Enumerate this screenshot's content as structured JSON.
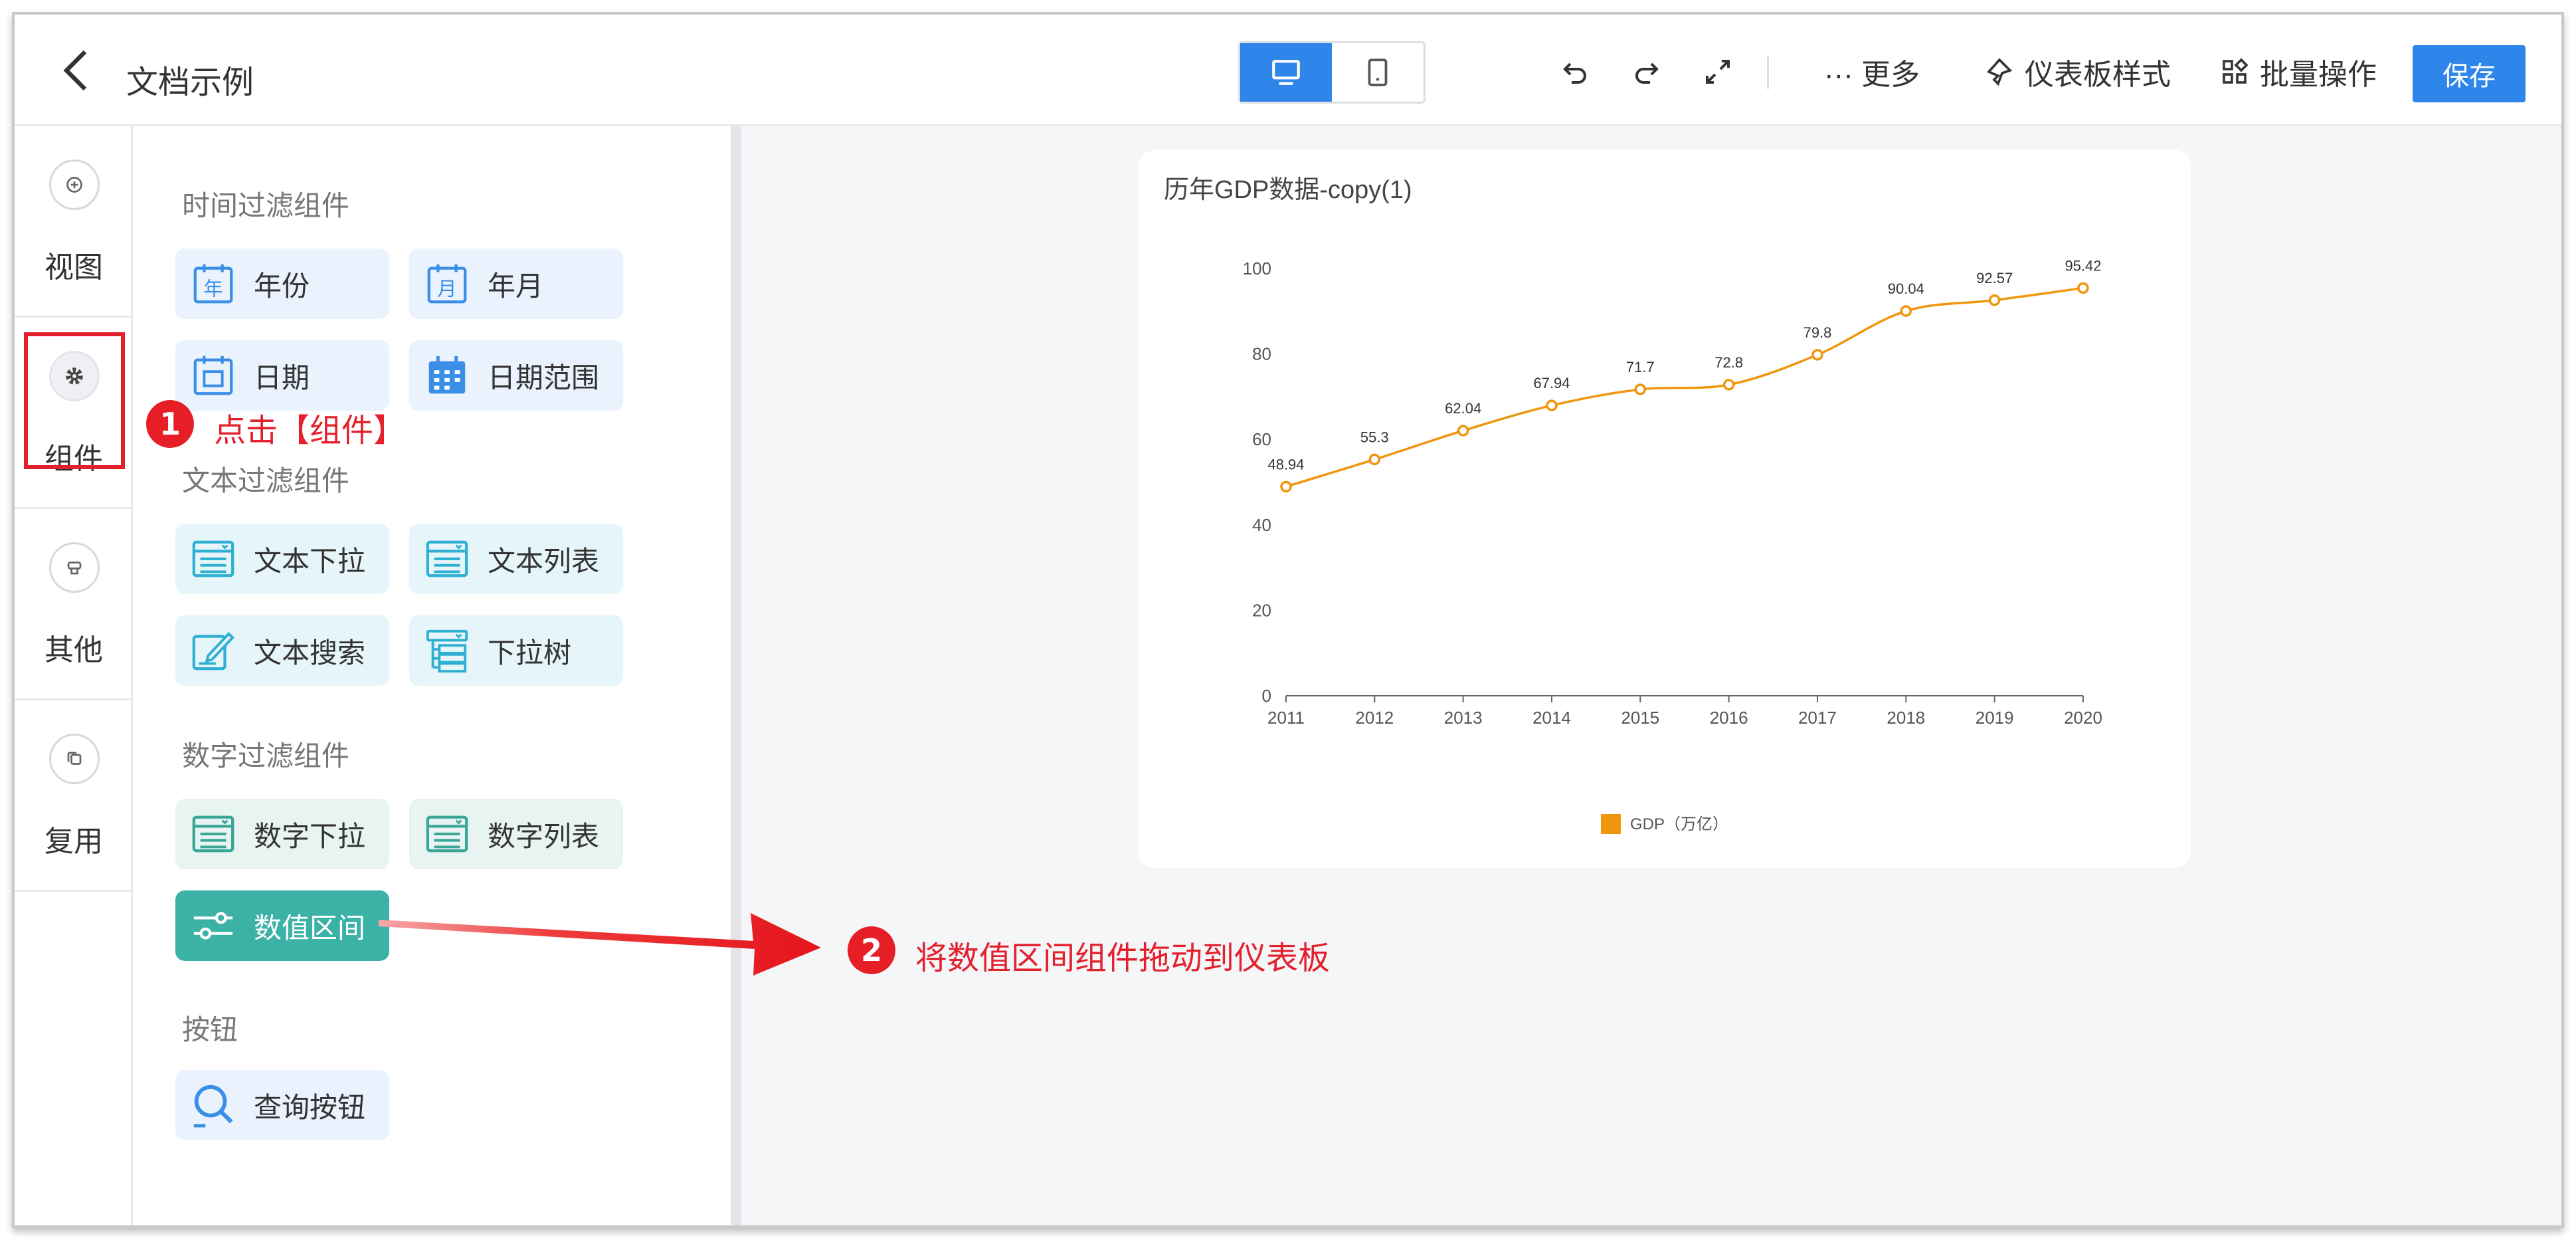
{
  "header": {
    "title": "文档示例",
    "more_label": "··· 更多",
    "dashboard_style_label": "仪表板样式",
    "batch_label": "批量操作",
    "save_label": "保存"
  },
  "rail": {
    "items": [
      {
        "label": "视图",
        "icon": "plus-circle-icon"
      },
      {
        "label": "组件",
        "icon": "gear-icon"
      },
      {
        "label": "其他",
        "icon": "stamp-icon"
      },
      {
        "label": "复用",
        "icon": "copy-icon"
      }
    ]
  },
  "panel": {
    "sections": [
      {
        "title": "时间过滤组件"
      },
      {
        "title": "文本过滤组件"
      },
      {
        "title": "数字过滤组件"
      },
      {
        "title": "按钮"
      }
    ],
    "chips": {
      "year": "年份",
      "year_month": "年月",
      "date": "日期",
      "date_range": "日期范围",
      "text_dropdown": "文本下拉",
      "text_list": "文本列表",
      "text_search": "文本搜索",
      "dropdown_tree": "下拉树",
      "number_dropdown": "数字下拉",
      "number_list": "数字列表",
      "number_range": "数值区间",
      "query_button": "查询按钮"
    },
    "icon_glyphs": {
      "year": "年",
      "month": "月"
    }
  },
  "annotations": {
    "step1_number": "1",
    "step1_text": "点击【组件】",
    "step2_number": "2",
    "step2_text": "将数值区间组件拖动到仪表板"
  },
  "colors": {
    "accent": "#2f86ea",
    "teal": "#3cb1a6",
    "annotation_red": "#e4202d",
    "series": "#f0960e"
  },
  "chart_data": {
    "type": "line",
    "title": "历年GDP数据-copy(1)",
    "categories": [
      "2011",
      "2012",
      "2013",
      "2014",
      "2015",
      "2016",
      "2017",
      "2018",
      "2019",
      "2020"
    ],
    "series": [
      {
        "name": "GDP（万亿）",
        "values": [
          48.94,
          55.3,
          62.04,
          67.94,
          71.7,
          72.8,
          79.8,
          90.04,
          92.57,
          95.42
        ]
      }
    ],
    "data_labels": [
      "48.94",
      "55.3",
      "62.04",
      "67.94",
      "71.7",
      "72.8",
      "79.8",
      "90.04",
      "92.57",
      "95.42"
    ],
    "yticks": [
      "0",
      "20",
      "40",
      "60",
      "80",
      "100"
    ],
    "ylim": [
      0,
      100
    ],
    "smooth": true,
    "grid": false,
    "legend": "bottom-center"
  }
}
